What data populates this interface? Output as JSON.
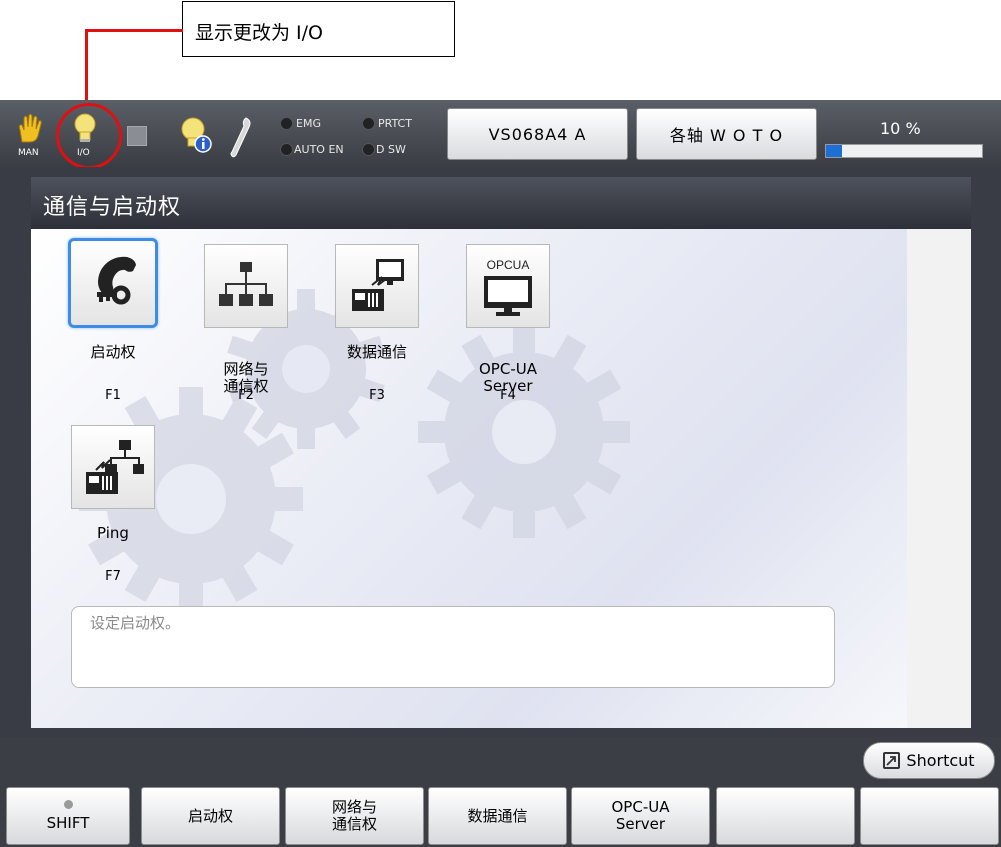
{
  "callout": {
    "text": "显示更改为 I/O",
    "line_color": "#e01010"
  },
  "status_bar": {
    "man_label": "MAN",
    "io_label": "I/O",
    "leds": [
      {
        "label": "EMG"
      },
      {
        "label": "PRTCT"
      },
      {
        "label": "AUTO EN"
      },
      {
        "label": "D SW"
      }
    ],
    "robot_button": "VS068A4 A",
    "axis_button": "各轴 W O T O",
    "speed_text": "10 %",
    "speed_value": 0.1
  },
  "panel": {
    "title": "通信与启动权",
    "tiles": [
      {
        "label": "启动权",
        "key": "F1",
        "icon": "telephone-key-icon",
        "selected": true
      },
      {
        "label": "网络与\n通信权",
        "key": "F2",
        "icon": "network-tree-icon",
        "selected": false
      },
      {
        "label": "数据通信",
        "key": "F3",
        "icon": "data-communication-icon",
        "selected": false
      },
      {
        "label": "OPC-UA\nServer",
        "key": "F4",
        "icon": "opcua-monitor-icon",
        "selected": false,
        "icon_text": "OPCUA"
      },
      {
        "label": "Ping",
        "key": "F7",
        "icon": "ping-icon",
        "selected": false
      }
    ],
    "description": "设定启动权。"
  },
  "bottom": {
    "shortcut_label": "Shortcut",
    "fkeys": [
      {
        "label": "SHIFT"
      },
      {
        "label": "启动权"
      },
      {
        "label": "网络与\n通信权"
      },
      {
        "label": "数据通信"
      },
      {
        "label": "OPC-UA\nServer"
      },
      {
        "label": ""
      },
      {
        "label": ""
      }
    ]
  },
  "colors": {
    "accent": "#3d8de8",
    "speed_fill": "#1d6fd6",
    "callout": "#e01010"
  }
}
